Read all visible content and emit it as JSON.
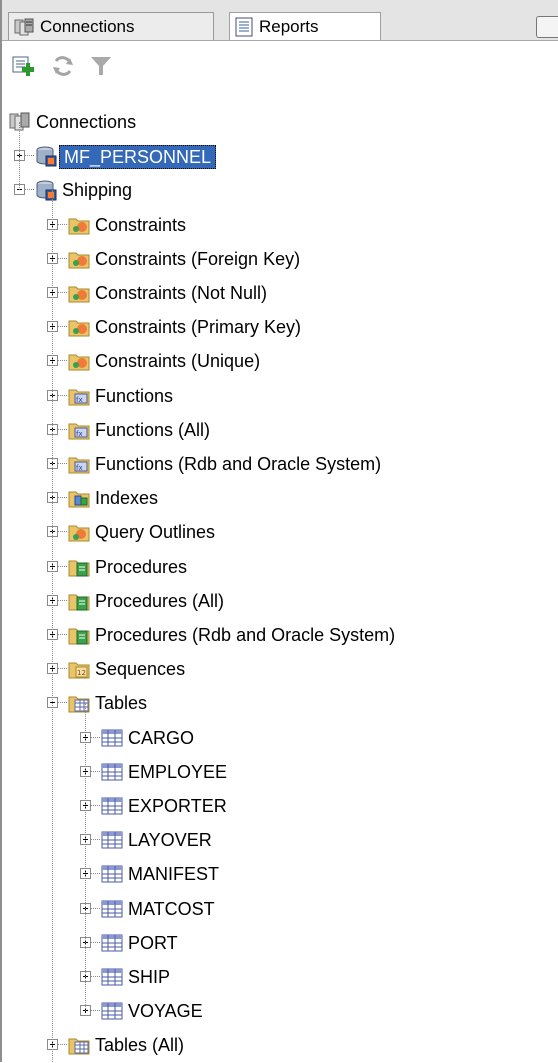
{
  "tabs": [
    {
      "label": "Connections",
      "icon": "connections-icon"
    },
    {
      "label": "Reports",
      "icon": "reports-icon"
    }
  ],
  "toolbar": [
    {
      "name": "new-connection-icon"
    },
    {
      "name": "refresh-icon"
    },
    {
      "name": "filter-icon"
    }
  ],
  "tree": {
    "root": "Connections",
    "connections": [
      {
        "label": "MF_PERSONNEL",
        "selected": true,
        "expanded": false
      },
      {
        "label": "Shipping",
        "expanded": true
      }
    ],
    "shipping_nodes": [
      {
        "label": "Constraints",
        "icon": "constraints-folder-icon"
      },
      {
        "label": "Constraints (Foreign Key)",
        "icon": "constraints-folder-icon"
      },
      {
        "label": "Constraints (Not Null)",
        "icon": "constraints-folder-icon"
      },
      {
        "label": "Constraints (Primary Key)",
        "icon": "constraints-folder-icon"
      },
      {
        "label": "Constraints (Unique)",
        "icon": "constraints-folder-icon"
      },
      {
        "label": "Functions",
        "icon": "functions-folder-icon"
      },
      {
        "label": "Functions (All)",
        "icon": "functions-folder-icon"
      },
      {
        "label": "Functions (Rdb and Oracle System)",
        "icon": "functions-folder-icon"
      },
      {
        "label": "Indexes",
        "icon": "indexes-folder-icon"
      },
      {
        "label": "Query Outlines",
        "icon": "query-outlines-folder-icon"
      },
      {
        "label": "Procedures",
        "icon": "procedures-folder-icon"
      },
      {
        "label": "Procedures (All)",
        "icon": "procedures-folder-icon"
      },
      {
        "label": "Procedures (Rdb and Oracle System)",
        "icon": "procedures-folder-icon"
      },
      {
        "label": "Sequences",
        "icon": "sequences-folder-icon"
      },
      {
        "label": "Tables",
        "icon": "tables-folder-icon",
        "expanded": true
      }
    ],
    "tables": [
      "CARGO",
      "EMPLOYEE",
      "EXPORTER",
      "LAYOVER",
      "MANIFEST",
      "MATCOST",
      "PORT",
      "SHIP",
      "VOYAGE"
    ],
    "after_tables": [
      {
        "label": "Tables (All)",
        "icon": "tables-folder-icon"
      }
    ]
  },
  "colors": {
    "selection": "#3468b8",
    "tab_strip": "#e4e4e4",
    "connector": "#8a8a8a"
  }
}
